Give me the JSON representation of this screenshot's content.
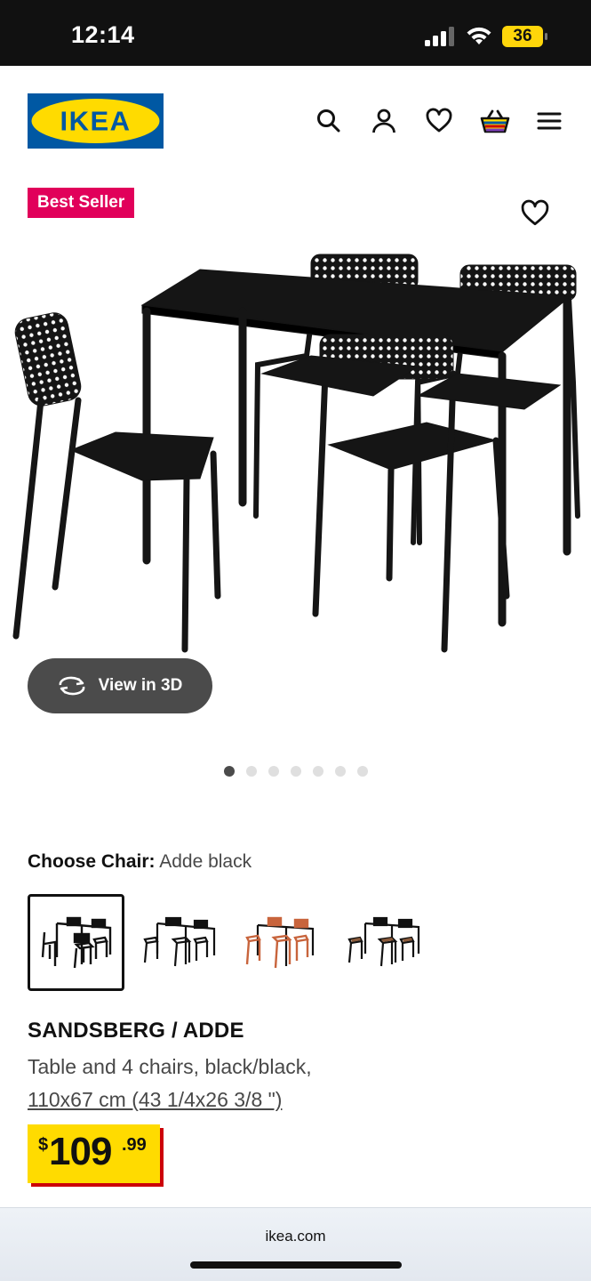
{
  "status_bar": {
    "time": "12:14",
    "battery": "36"
  },
  "brand": {
    "logo_text": "IKEA",
    "blue": "#0058a3",
    "yellow": "#ffdb00"
  },
  "header": {
    "icons": [
      "search-icon",
      "account-icon",
      "heart-icon",
      "basket-icon",
      "menu-icon"
    ]
  },
  "product": {
    "badge": "Best Seller",
    "view_3d_label": "View in 3D",
    "gallery": {
      "total_images": 7,
      "current_index": 1
    },
    "choose_label": "Choose Chair:",
    "choose_value": "Adde black",
    "chair_options": [
      {
        "color": "#111111",
        "selected": true
      },
      {
        "color": "#111111",
        "selected": false
      },
      {
        "color": "#c8643c",
        "selected": false
      },
      {
        "color": "#8a5a3a",
        "selected": false
      }
    ],
    "name": "SANDSBERG / ADDE",
    "description": "Table and 4 chairs, black/black,",
    "size": "110x67 cm (43 1/4x26 3/8 \")",
    "price": {
      "currency": "$",
      "integer": "109",
      "decimal": ".99"
    }
  },
  "browser": {
    "url": "ikea.com"
  }
}
